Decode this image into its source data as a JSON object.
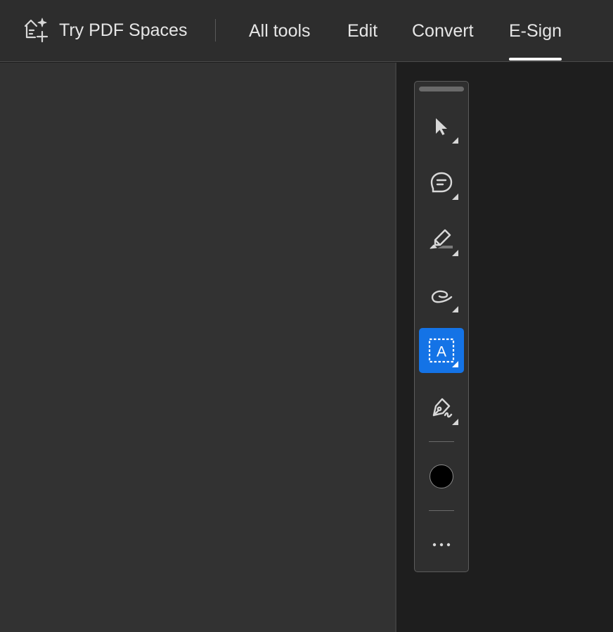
{
  "header": {
    "spaces_label": "Try PDF Spaces",
    "spaces_icon": "spaces-sparkle-icon",
    "tabs": [
      {
        "label": "All tools",
        "active": false
      },
      {
        "label": "Edit",
        "active": false
      },
      {
        "label": "Convert",
        "active": false
      },
      {
        "label": "E-Sign",
        "active": true
      }
    ]
  },
  "toolbar": {
    "tools": [
      {
        "name": "select-tool",
        "icon": "arrow-pointer-icon",
        "active": false
      },
      {
        "name": "comment-tool",
        "icon": "comment-bubble-icon",
        "active": false
      },
      {
        "name": "highlight-tool",
        "icon": "highlighter-icon",
        "active": false
      },
      {
        "name": "draw-tool",
        "icon": "freehand-loop-icon",
        "active": false
      },
      {
        "name": "text-box-tool",
        "icon": "text-box-icon",
        "active": true
      },
      {
        "name": "sign-tool",
        "icon": "pen-sign-icon",
        "active": false
      }
    ],
    "text_box_glyph": "A",
    "current_color": "#000000",
    "accent_color": "#1473e6",
    "more_icon": "ellipsis-icon"
  }
}
